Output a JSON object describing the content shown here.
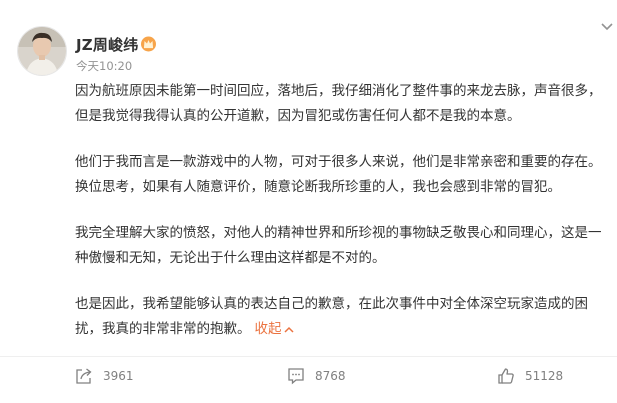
{
  "post": {
    "author": "JZ周峻纬",
    "time": "今天10:20",
    "paragraphs": [
      "因为航班原因未能第一时间回应，落地后，我仔细消化了整件事的来龙去脉，声音很多，但是我觉得我得认真的公开道歉，因为冒犯或伤害任何人都不是我的本意。",
      "他们于我而言是一款游戏中的人物，可对于很多人来说，他们是非常亲密和重要的存在。换位思考，如果有人随意评价，随意论断我所珍重的人，我也会感到非常的冒犯。",
      "我完全理解大家的愤怒，对他人的精神世界和所珍视的事物缺乏敬畏心和同理心，这是一种傲慢和无知，无论出于什么理由这样都是不对的。",
      "也是因此，我希望能够认真的表达自己的歉意，在此次事件中对全体深空玩家造成的困扰，我真的非常非常的抱歉。"
    ],
    "collapse_label": "收起",
    "accent_color": "#eb7340"
  },
  "actions": {
    "share_count": "3961",
    "comment_count": "8768",
    "like_count": "51128"
  },
  "icons": {
    "badge": "vip-crown-icon",
    "more": "chevron-down-icon",
    "share": "share-icon",
    "comment": "comment-icon",
    "like": "thumbs-up-icon"
  }
}
